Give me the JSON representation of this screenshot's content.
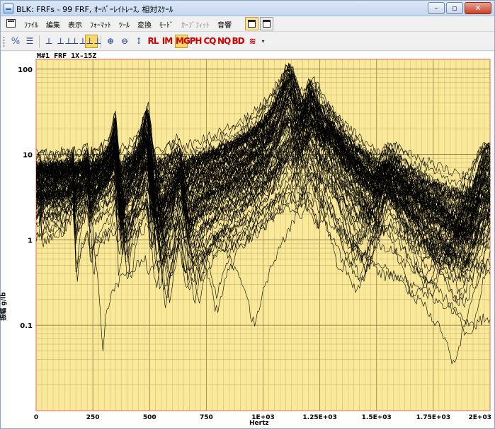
{
  "window": {
    "title": "BLK: FRFs - 99 FRF, ｵｰﾊﾞｰﾚｲﾄﾚｰｽ, 相対ｽｹｰﾙ",
    "controls": {
      "minimize": "–",
      "maximize": "▫",
      "close": "✕"
    }
  },
  "menu": {
    "items": [
      {
        "label": "ﾌｧｲﾙ",
        "dim": false
      },
      {
        "label": "編集",
        "dim": false
      },
      {
        "label": "表示",
        "dim": false
      },
      {
        "label": "ﾌｫｰﾏｯﾄ",
        "dim": false
      },
      {
        "label": "ﾂｰﾙ",
        "dim": false
      },
      {
        "label": "変換",
        "dim": false
      },
      {
        "label": "ﾓｰﾄﾞ",
        "dim": false
      },
      {
        "label": "ｶｰﾌﾞﾌｨｯﾄ",
        "dim": true
      },
      {
        "label": "音響",
        "dim": false
      }
    ]
  },
  "toolbar": {
    "items": [
      {
        "name": "cursor-readout-tool",
        "glyph": "⁰⁄₈",
        "style": ""
      },
      {
        "name": "list-tool",
        "glyph": "☰",
        "style": ""
      },
      {
        "name": "single-cursor-tool",
        "glyph": "⊥",
        "style": ""
      },
      {
        "name": "dual-cursor-tool",
        "glyph": "⊥⊥",
        "style": ""
      },
      {
        "name": "peak-cursor-tool",
        "glyph": "⊥⊥",
        "style": ""
      },
      {
        "name": "band-cursor-tool",
        "glyph": "⊥⊥",
        "style": "on"
      },
      {
        "name": "zoom-in-tool",
        "glyph": "⊕",
        "style": ""
      },
      {
        "name": "zoom-out-tool",
        "glyph": "⊖",
        "style": ""
      },
      {
        "name": "vertical-scale-tool",
        "glyph": "↕",
        "style": ""
      },
      {
        "name": "real-part-tool",
        "glyph": "RL",
        "style": "red"
      },
      {
        "name": "imaginary-part-tool",
        "glyph": "IM",
        "style": "red"
      },
      {
        "name": "magnitude-tool",
        "glyph": "MG",
        "style": "red on"
      },
      {
        "name": "phase-tool",
        "glyph": "PH",
        "style": "red"
      },
      {
        "name": "coquad-tool",
        "glyph": "CQ",
        "style": "red"
      },
      {
        "name": "nyquist-tool",
        "glyph": "NQ",
        "style": "red"
      },
      {
        "name": "bode-tool",
        "glyph": "BD",
        "style": "red"
      },
      {
        "name": "overlay-traces-tool",
        "glyph": "≋",
        "style": "red"
      }
    ]
  },
  "plot": {
    "title": "M#1 FRF 1X-15Z",
    "background": "#fbe99a",
    "border": "#e06a55",
    "grid_major": "#8b7d4a",
    "grid_minor": "#b9a866",
    "trace_color": "#000000"
  },
  "chart_data": {
    "type": "line",
    "title": "M#1 FRF 1X-15Z",
    "xlabel": "Hertz",
    "ylabel": "振幅 g/lb",
    "xlim": [
      0,
      2000
    ],
    "ylim": [
      0.01,
      130
    ],
    "yscale": "log",
    "grid": true,
    "x_ticks": [
      {
        "value": 0,
        "label": "0"
      },
      {
        "value": 250,
        "label": "250"
      },
      {
        "value": 500,
        "label": "500"
      },
      {
        "value": 750,
        "label": "750"
      },
      {
        "value": 1000,
        "label": "1E+03"
      },
      {
        "value": 1250,
        "label": "1.25E+03"
      },
      {
        "value": 1500,
        "label": "1.5E+03"
      },
      {
        "value": 1750,
        "label": "1.75E+03"
      },
      {
        "value": 2000,
        "label": "2E+03"
      }
    ],
    "y_ticks": [
      {
        "value": 100,
        "label": "100"
      },
      {
        "value": 10,
        "label": "10"
      },
      {
        "value": 1,
        "label": "1"
      },
      {
        "value": 0.1,
        "label": "0.1"
      }
    ],
    "series_count": 99,
    "resonance_peaks_hz": [
      20,
      165,
      230,
      350,
      490,
      640,
      1120,
      1210,
      1280,
      1540,
      1990
    ],
    "peak_magnitudes": [
      3,
      8,
      7,
      30,
      40,
      8.5,
      120,
      70,
      20,
      9,
      14
    ]
  }
}
